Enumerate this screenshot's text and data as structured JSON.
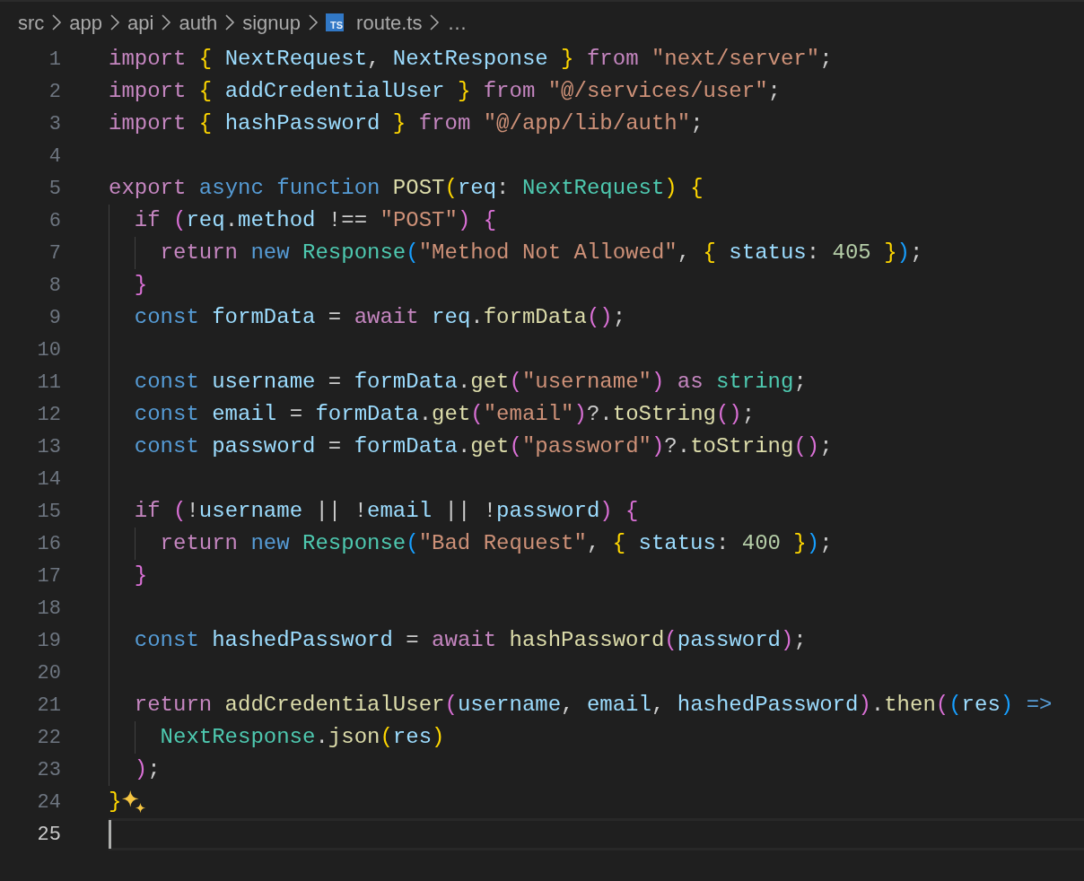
{
  "breadcrumb": [
    {
      "text": "src"
    },
    {
      "text": "app"
    },
    {
      "text": "api"
    },
    {
      "text": "auth"
    },
    {
      "text": "signup"
    },
    {
      "text": "route.ts",
      "kind": "ts-file",
      "icon_text": "TS"
    },
    {
      "text": "…"
    }
  ],
  "lines": [
    {
      "number": "1",
      "tokens": [
        {
          "kind": "kw",
          "text": "import"
        },
        {
          "kind": "y",
          "text": " {"
        },
        {
          "kind": "var",
          "text": " NextRequest"
        },
        {
          "kind": "p",
          "text": ","
        },
        {
          "kind": "var",
          "text": " NextResponse"
        },
        {
          "kind": "y",
          "text": " }"
        },
        {
          "kind": "kw",
          "text": " from"
        },
        {
          "kind": "str",
          "text": " \"next/server\""
        },
        {
          "kind": "p",
          "text": ";"
        }
      ]
    },
    {
      "number": "2",
      "tokens": [
        {
          "kind": "kw",
          "text": "import"
        },
        {
          "kind": "y",
          "text": " {"
        },
        {
          "kind": "var",
          "text": " addCredentialUser"
        },
        {
          "kind": "y",
          "text": " }"
        },
        {
          "kind": "kw",
          "text": " from"
        },
        {
          "kind": "str",
          "text": " \"@/services/user\""
        },
        {
          "kind": "p",
          "text": ";"
        }
      ]
    },
    {
      "number": "3",
      "tokens": [
        {
          "kind": "kw",
          "text": "import"
        },
        {
          "kind": "y",
          "text": " {"
        },
        {
          "kind": "var",
          "text": " hashPassword"
        },
        {
          "kind": "y",
          "text": " }"
        },
        {
          "kind": "kw",
          "text": " from"
        },
        {
          "kind": "str",
          "text": " \"@/app/lib/auth\""
        },
        {
          "kind": "p",
          "text": ";"
        }
      ]
    },
    {
      "number": "4"
    },
    {
      "number": "5",
      "tokens": [
        {
          "kind": "kw",
          "text": "export"
        },
        {
          "kind": "st",
          "text": " async"
        },
        {
          "kind": "st",
          "text": " function"
        },
        {
          "kind": "fn",
          "text": " POST"
        },
        {
          "kind": "y",
          "text": "("
        },
        {
          "kind": "var",
          "text": "req"
        },
        {
          "kind": "p",
          "text": ": "
        },
        {
          "kind": "type",
          "text": "NextRequest"
        },
        {
          "kind": "y",
          "text": ")"
        },
        {
          "kind": "y",
          "text": " {"
        }
      ],
      "children": [
        {
          "number": "6",
          "tokens": [
            {
              "kind": "kw",
              "text": "if"
            },
            {
              "kind": "m",
              "text": " ("
            },
            {
              "kind": "var",
              "text": "req"
            },
            {
              "kind": "p",
              "text": "."
            },
            {
              "kind": "var",
              "text": "method"
            },
            {
              "kind": "p",
              "text": " !== "
            },
            {
              "kind": "str",
              "text": "\"POST\""
            },
            {
              "kind": "m",
              "text": ")"
            },
            {
              "kind": "m",
              "text": " {"
            }
          ],
          "children": [
            {
              "number": "7",
              "tokens": [
                {
                  "kind": "kw",
                  "text": "return"
                },
                {
                  "kind": "st",
                  "text": " new"
                },
                {
                  "kind": "type",
                  "text": " Response"
                },
                {
                  "kind": "b",
                  "text": "("
                },
                {
                  "kind": "str",
                  "text": "\"Method Not Allowed\""
                },
                {
                  "kind": "p",
                  "text": ", "
                },
                {
                  "kind": "y",
                  "text": "{"
                },
                {
                  "kind": "var",
                  "text": " status"
                },
                {
                  "kind": "p",
                  "text": ": "
                },
                {
                  "kind": "num",
                  "text": "405"
                },
                {
                  "kind": "y",
                  "text": " }"
                },
                {
                  "kind": "b",
                  "text": ")"
                },
                {
                  "kind": "p",
                  "text": ";"
                }
              ]
            }
          ]
        },
        {
          "number": "8",
          "tokens": [
            {
              "kind": "m",
              "text": "}"
            }
          ]
        },
        {
          "number": "9",
          "tokens": [
            {
              "kind": "st",
              "text": "const"
            },
            {
              "kind": "var",
              "text": " formData"
            },
            {
              "kind": "p",
              "text": " = "
            },
            {
              "kind": "kw",
              "text": "await"
            },
            {
              "kind": "var",
              "text": " req"
            },
            {
              "kind": "p",
              "text": "."
            },
            {
              "kind": "fn",
              "text": "formData"
            },
            {
              "kind": "m",
              "text": "()"
            },
            {
              "kind": "p",
              "text": ";"
            }
          ]
        },
        {
          "number": "10"
        },
        {
          "number": "11",
          "tokens": [
            {
              "kind": "st",
              "text": "const"
            },
            {
              "kind": "var",
              "text": " username"
            },
            {
              "kind": "p",
              "text": " = "
            },
            {
              "kind": "var",
              "text": "formData"
            },
            {
              "kind": "p",
              "text": "."
            },
            {
              "kind": "fn",
              "text": "get"
            },
            {
              "kind": "m",
              "text": "("
            },
            {
              "kind": "str",
              "text": "\"username\""
            },
            {
              "kind": "m",
              "text": ")"
            },
            {
              "kind": "kw",
              "text": " as"
            },
            {
              "kind": "type",
              "text": " string"
            },
            {
              "kind": "p",
              "text": ";"
            }
          ]
        },
        {
          "number": "12",
          "tokens": [
            {
              "kind": "st",
              "text": "const"
            },
            {
              "kind": "var",
              "text": " email"
            },
            {
              "kind": "p",
              "text": " = "
            },
            {
              "kind": "var",
              "text": "formData"
            },
            {
              "kind": "p",
              "text": "."
            },
            {
              "kind": "fn",
              "text": "get"
            },
            {
              "kind": "m",
              "text": "("
            },
            {
              "kind": "str",
              "text": "\"email\""
            },
            {
              "kind": "m",
              "text": ")"
            },
            {
              "kind": "p",
              "text": "?."
            },
            {
              "kind": "fn",
              "text": "toString"
            },
            {
              "kind": "m",
              "text": "()"
            },
            {
              "kind": "p",
              "text": ";"
            }
          ]
        },
        {
          "number": "13",
          "tokens": [
            {
              "kind": "st",
              "text": "const"
            },
            {
              "kind": "var",
              "text": " password"
            },
            {
              "kind": "p",
              "text": " = "
            },
            {
              "kind": "var",
              "text": "formData"
            },
            {
              "kind": "p",
              "text": "."
            },
            {
              "kind": "fn",
              "text": "get"
            },
            {
              "kind": "m",
              "text": "("
            },
            {
              "kind": "str",
              "text": "\"password\""
            },
            {
              "kind": "m",
              "text": ")"
            },
            {
              "kind": "p",
              "text": "?."
            },
            {
              "kind": "fn",
              "text": "toString"
            },
            {
              "kind": "m",
              "text": "()"
            },
            {
              "kind": "p",
              "text": ";"
            }
          ]
        },
        {
          "number": "14"
        },
        {
          "number": "15",
          "tokens": [
            {
              "kind": "kw",
              "text": "if"
            },
            {
              "kind": "m",
              "text": " ("
            },
            {
              "kind": "p",
              "text": "!"
            },
            {
              "kind": "var",
              "text": "username"
            },
            {
              "kind": "p",
              "text": " || !"
            },
            {
              "kind": "var",
              "text": "email"
            },
            {
              "kind": "p",
              "text": " || !"
            },
            {
              "kind": "var",
              "text": "password"
            },
            {
              "kind": "m",
              "text": ")"
            },
            {
              "kind": "m",
              "text": " {"
            }
          ],
          "children": [
            {
              "number": "16",
              "tokens": [
                {
                  "kind": "kw",
                  "text": "return"
                },
                {
                  "kind": "st",
                  "text": " new"
                },
                {
                  "kind": "type",
                  "text": " Response"
                },
                {
                  "kind": "b",
                  "text": "("
                },
                {
                  "kind": "str",
                  "text": "\"Bad Request\""
                },
                {
                  "kind": "p",
                  "text": ", "
                },
                {
                  "kind": "y",
                  "text": "{"
                },
                {
                  "kind": "var",
                  "text": " status"
                },
                {
                  "kind": "p",
                  "text": ": "
                },
                {
                  "kind": "num",
                  "text": "400"
                },
                {
                  "kind": "y",
                  "text": " }"
                },
                {
                  "kind": "b",
                  "text": ")"
                },
                {
                  "kind": "p",
                  "text": ";"
                }
              ]
            }
          ]
        },
        {
          "number": "17",
          "tokens": [
            {
              "kind": "m",
              "text": "}"
            }
          ]
        },
        {
          "number": "18"
        },
        {
          "number": "19",
          "tokens": [
            {
              "kind": "st",
              "text": "const"
            },
            {
              "kind": "var",
              "text": " hashedPassword"
            },
            {
              "kind": "p",
              "text": " = "
            },
            {
              "kind": "kw",
              "text": "await"
            },
            {
              "kind": "fn",
              "text": " hashPassword"
            },
            {
              "kind": "m",
              "text": "("
            },
            {
              "kind": "var",
              "text": "password"
            },
            {
              "kind": "m",
              "text": ")"
            },
            {
              "kind": "p",
              "text": ";"
            }
          ]
        },
        {
          "number": "20"
        },
        {
          "number": "21",
          "tokens": [
            {
              "kind": "kw",
              "text": "return"
            },
            {
              "kind": "fn",
              "text": " addCredentialUser"
            },
            {
              "kind": "m",
              "text": "("
            },
            {
              "kind": "var",
              "text": "username"
            },
            {
              "kind": "p",
              "text": ", "
            },
            {
              "kind": "var",
              "text": "email"
            },
            {
              "kind": "p",
              "text": ", "
            },
            {
              "kind": "var",
              "text": "hashedPassword"
            },
            {
              "kind": "m",
              "text": ")"
            },
            {
              "kind": "p",
              "text": "."
            },
            {
              "kind": "fn",
              "text": "then"
            },
            {
              "kind": "m",
              "text": "("
            },
            {
              "kind": "b",
              "text": "("
            },
            {
              "kind": "var",
              "text": "res"
            },
            {
              "kind": "b",
              "text": ")"
            },
            {
              "kind": "st",
              "text": " =>"
            }
          ],
          "children": [
            {
              "number": "22",
              "tokens": [
                {
                  "kind": "type",
                  "text": "NextResponse"
                },
                {
                  "kind": "p",
                  "text": "."
                },
                {
                  "kind": "fn",
                  "text": "json"
                },
                {
                  "kind": "y",
                  "text": "("
                },
                {
                  "kind": "var",
                  "text": "res"
                },
                {
                  "kind": "y",
                  "text": ")"
                }
              ]
            }
          ]
        },
        {
          "number": "23",
          "tokens": [
            {
              "kind": "m",
              "text": ")"
            },
            {
              "kind": "p",
              "text": ";"
            }
          ]
        }
      ]
    },
    {
      "number": "24",
      "tokens": [
        {
          "kind": "y",
          "text": "}"
        }
      ],
      "sparkle": true
    },
    {
      "number": "25",
      "current": true
    }
  ]
}
